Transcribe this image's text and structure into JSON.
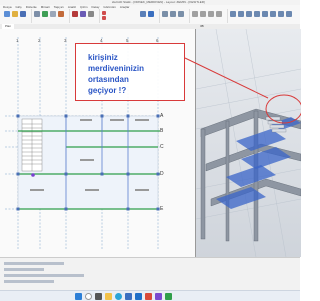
{
  "window": {
    "title": "ideCAD Statik - [ORNEK_MERDIVEN] - Layout: ZEMIN - [KESITLER]"
  },
  "ribbon": {
    "tabs": [
      "Dosya",
      "Giriş",
      "Düzenle",
      "Mimari",
      "Taşıyıcı",
      "Analiz",
      "Çizim",
      "Detay",
      "Görünüm",
      "Araçlar"
    ]
  },
  "viewtabs": [
    {
      "label": "Plan"
    },
    {
      "label": "3B"
    }
  ],
  "plan": {
    "grid_columns": [
      "1",
      "2",
      "3",
      "4",
      "5",
      "6"
    ],
    "grid_rows": [
      "A",
      "B",
      "C",
      "D",
      "E"
    ]
  },
  "annotation": {
    "text": "kirişiniz\nmerdiveninizin\nortasından\ngeçiyor !?"
  },
  "colors": {
    "annotation_border": "#d83a3a",
    "annotation_text": "#2a55c5",
    "grid_line": "#7aa0c8",
    "beam": "#2f9e4a",
    "column": "#4a6fb5",
    "slab_3d": "#3a64c8"
  },
  "taskbar": {
    "icons": [
      "windows-start-icon",
      "search-icon",
      "task-view-icon",
      "explorer-icon",
      "edge-icon",
      "store-icon",
      "mail-icon",
      "app-icon",
      "app-icon-2",
      "app-icon-3"
    ]
  }
}
